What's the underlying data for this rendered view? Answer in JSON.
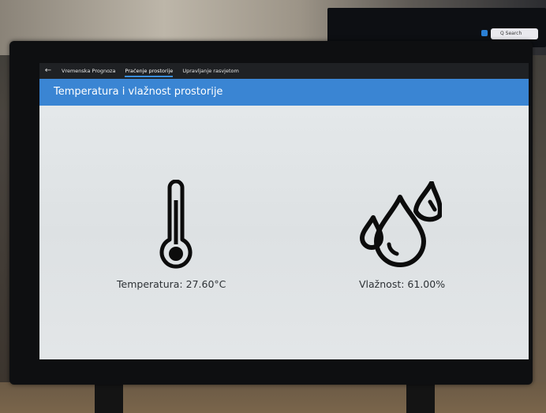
{
  "background": {
    "search_text": "Q Search"
  },
  "nav": {
    "back_icon": "arrow-left-icon",
    "tabs": [
      {
        "label": "Vremenska Prognoza",
        "active": false
      },
      {
        "label": "Praćenje prostorije",
        "active": true
      },
      {
        "label": "Upravljanje rasvjetom",
        "active": false
      }
    ]
  },
  "header": {
    "title": "Temperatura i vlažnost prostorije"
  },
  "readings": {
    "temperature_label": "Temperatura: 27.60°C",
    "humidity_label": "Vlažnost: 61.00%",
    "temperature_icon": "thermometer-icon",
    "humidity_icon": "water-drops-icon"
  },
  "colors": {
    "accent": "#3a85d3",
    "nav_bg": "#1f2124",
    "text": "#2e3236"
  }
}
